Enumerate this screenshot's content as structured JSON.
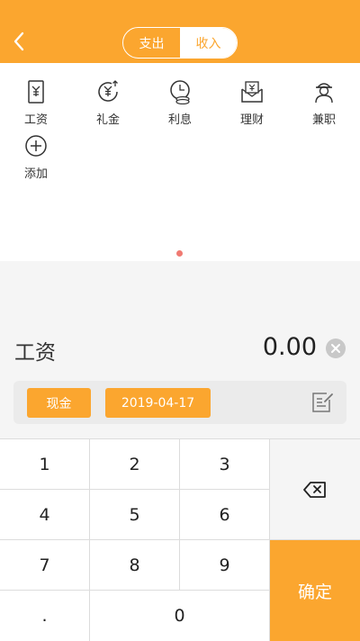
{
  "header": {
    "tabs": [
      "支出",
      "收入"
    ],
    "active_tab": "收入"
  },
  "categories": [
    {
      "label": "工资",
      "icon": "salary-icon"
    },
    {
      "label": "礼金",
      "icon": "gift-money-icon"
    },
    {
      "label": "利息",
      "icon": "interest-icon"
    },
    {
      "label": "理财",
      "icon": "finance-icon"
    },
    {
      "label": "兼职",
      "icon": "parttime-icon"
    },
    {
      "label": "添加",
      "icon": "add-icon"
    }
  ],
  "entry": {
    "category": "工资",
    "amount": "0.00",
    "account": "现金",
    "date": "2019-04-17"
  },
  "keypad": {
    "keys": [
      "1",
      "2",
      "3",
      "4",
      "5",
      "6",
      "7",
      "8",
      "9",
      ".",
      "0"
    ],
    "confirm_label": "确定"
  },
  "colors": {
    "accent": "#fba62f",
    "pager_dot": "#f07a72",
    "panel": "#f5f5f5"
  }
}
